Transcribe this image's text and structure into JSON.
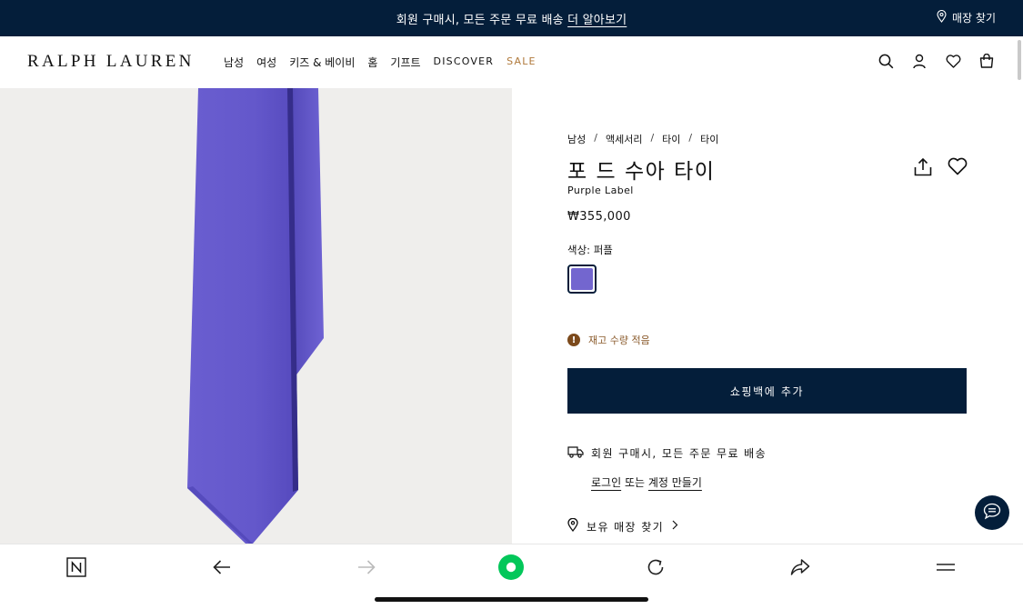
{
  "promo": {
    "text": "회원 구매시, 모든 주문 무료 배송",
    "link": "더 알아보기",
    "store_finder": "매장 찾기"
  },
  "header": {
    "logo": "RALPH LAUREN",
    "nav": [
      {
        "label": "남성"
      },
      {
        "label": "여성"
      },
      {
        "label": "키즈 & 베이비"
      },
      {
        "label": "홈"
      },
      {
        "label": "기프트"
      },
      {
        "label": "DISCOVER"
      },
      {
        "label": "SALE"
      }
    ],
    "icons": [
      "search-icon",
      "account-icon",
      "wishlist-icon",
      "bag-icon"
    ],
    "sale_color": "#b0793b"
  },
  "product": {
    "breadcrumb": [
      "남성",
      "액세서리",
      "타이",
      "타이"
    ],
    "breadcrumb_separator": "/",
    "title": "포 드 수아 타이",
    "brand": "Purple Label",
    "price": "₩355,000",
    "color_label": "색상: 퍼플",
    "swatch_color": "#7366cf",
    "stock_notice": "재고 수량 적음",
    "add_to_bag": "쇼핑백에 추가",
    "shipping_text": "회원 구매시, 모든 주문 무료 배송",
    "login_link": "로그인",
    "login_or": "또는",
    "create_account_link": "계정 만들기",
    "store_stock": "보유 매장 찾기"
  },
  "colors": {
    "navy": "#041e3a",
    "tie_purple": "#6b5fd0",
    "stock_brown": "#8a5a2b"
  },
  "toolbar": {
    "icons": [
      "n-logo-icon",
      "back-arrow-icon",
      "forward-arrow-icon",
      "record-icon",
      "reload-icon",
      "share-icon",
      "menu-icon"
    ]
  }
}
